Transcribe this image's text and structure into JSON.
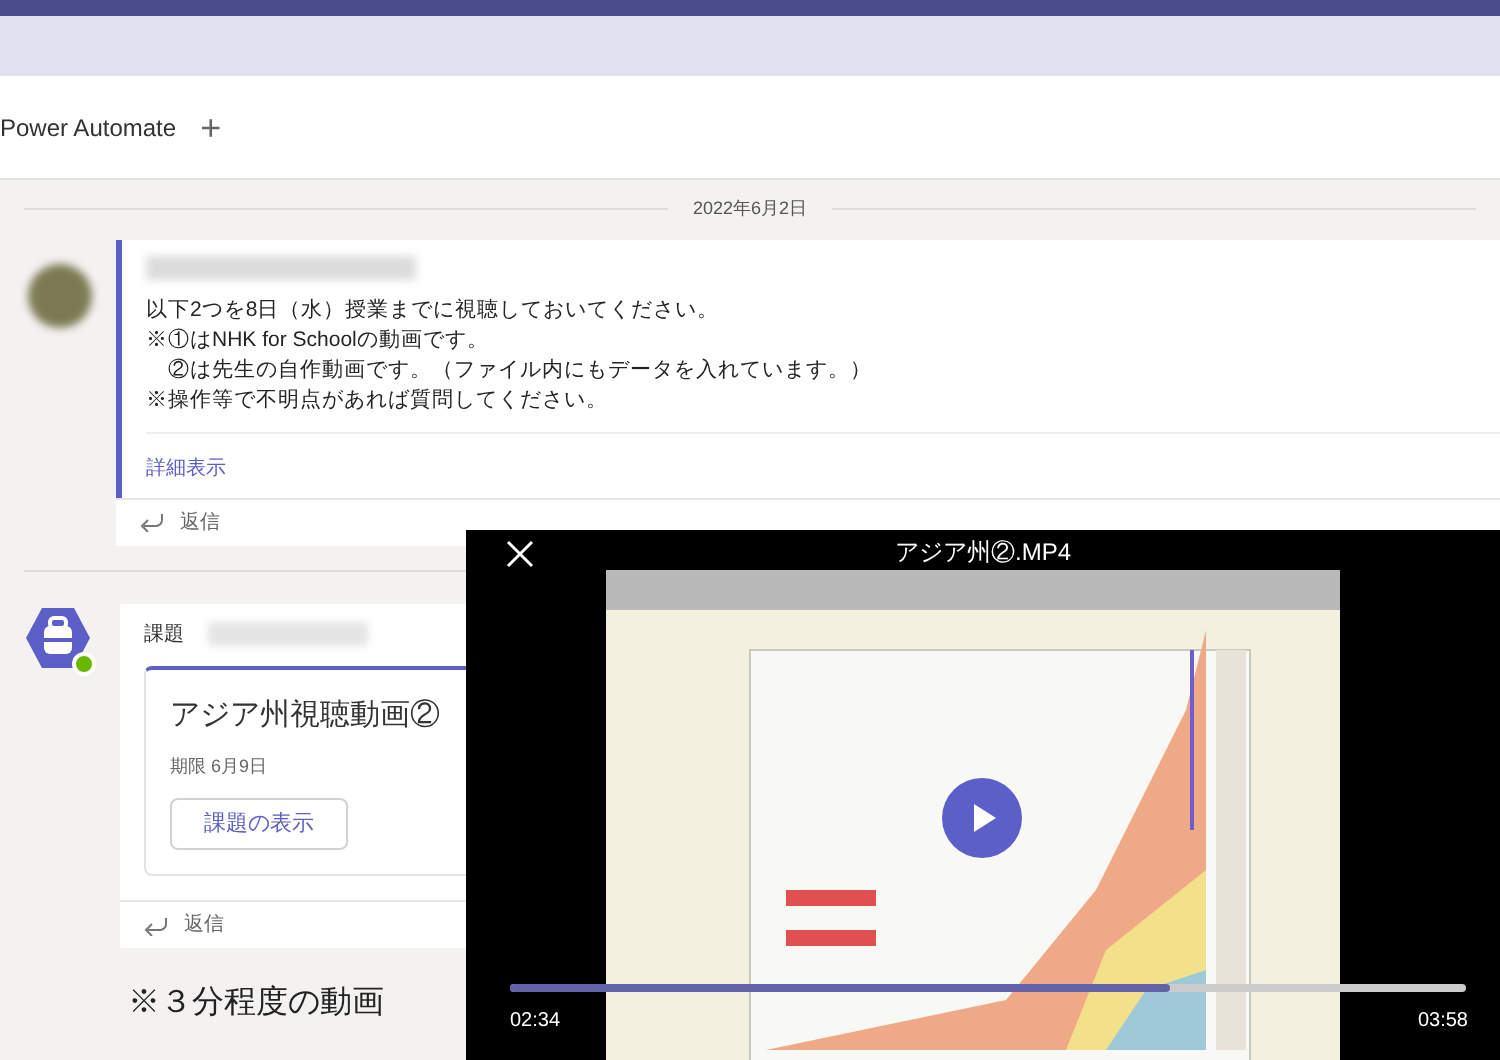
{
  "tabs": [
    {
      "label": "Power Automate"
    },
    {
      "label": "+"
    }
  ],
  "date_divider": "2022年6月2日",
  "message": {
    "lines": [
      "以下2つを8日（水）授業までに視聴しておいてください。",
      "※①はNHK for Schoolの動画です。",
      "　②は先生の自作動画です。（ファイル内にもデータを入れています。）",
      "※操作等で不明点があれば質問してください。"
    ],
    "more_link": "詳細表示",
    "reply": "返信"
  },
  "assignment": {
    "label": "課題",
    "title": "アジア州視聴動画②",
    "due": "期限 6月9日",
    "button": "課題の表示",
    "reply": "返信"
  },
  "caption": "※３分程度の動画",
  "video": {
    "title": "アジア州②.MP4",
    "elapsed": "02:34",
    "duration": "03:58",
    "level": 0.69
  }
}
